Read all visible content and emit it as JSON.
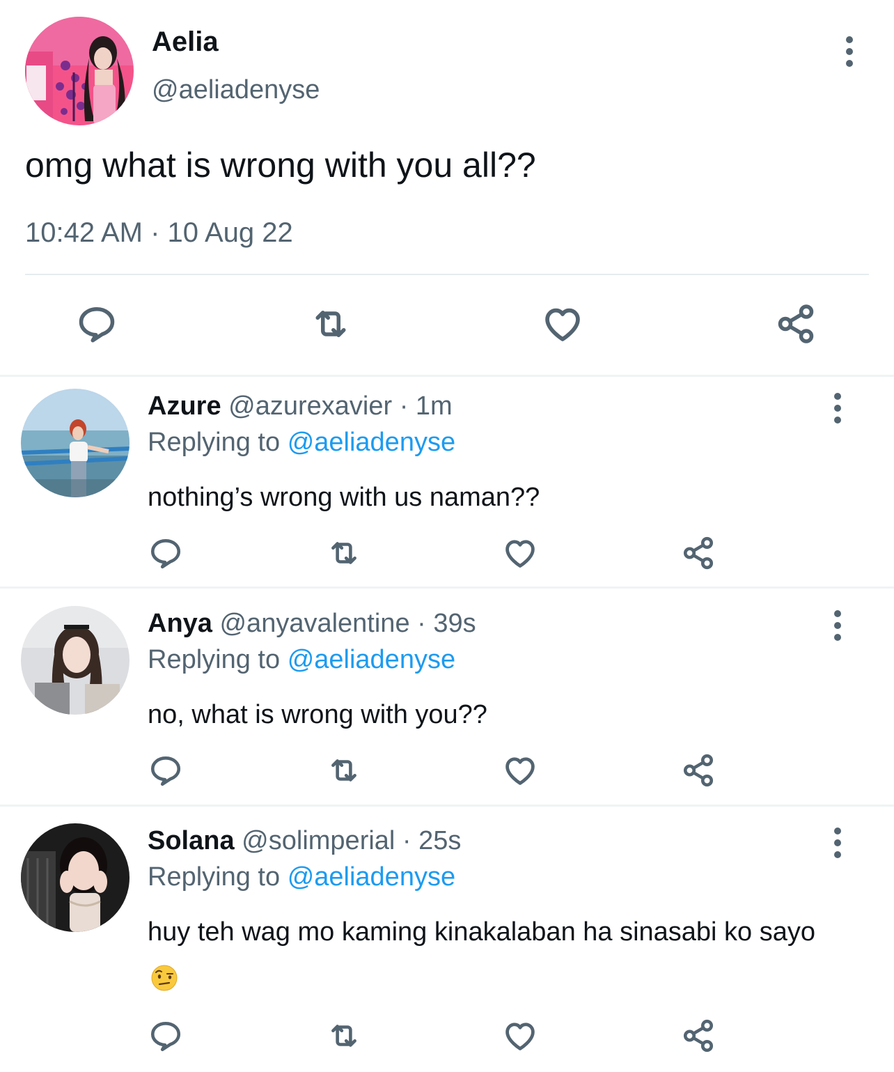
{
  "main_tweet": {
    "name": "Aelia",
    "handle": "@aeliadenyse",
    "text": "omg what is wrong with you all??",
    "timestamp": "10:42 AM · 10 Aug 22"
  },
  "replies": [
    {
      "name": "Azure",
      "handle_time": "@azurexavier · 1m",
      "replying_prefix": "Replying to",
      "replying_to": "@aeliadenyse",
      "text": "nothing’s wrong with us naman??"
    },
    {
      "name": "Anya",
      "handle_time": "@anyavalentine · 39s",
      "replying_prefix": "Replying to",
      "replying_to": "@aeliadenyse",
      "text": "no, what is wrong with you??"
    },
    {
      "name": "Solana",
      "handle_time": "@solimperial · 25s",
      "replying_prefix": "Replying to",
      "replying_to": "@aeliadenyse",
      "text": "huy teh wag mo kaming kinakalaban ha sinasabi ko sayo",
      "emoji": "face-with-raised-eyebrow"
    }
  ],
  "icons": [
    "reply-icon",
    "retweet-icon",
    "like-icon",
    "share-icon",
    "more-icon"
  ],
  "colors": {
    "text": "#0f1419",
    "secondary": "#536471",
    "link": "#1d9bf0",
    "divider": "#eff3f4"
  }
}
